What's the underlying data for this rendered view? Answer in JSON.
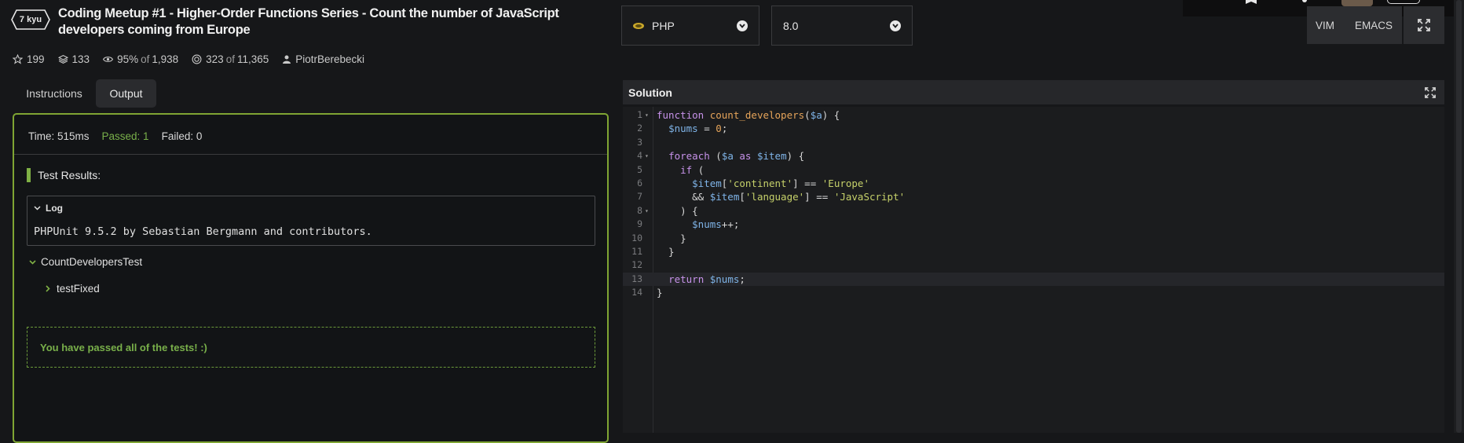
{
  "kata": {
    "rank": "7 kyu",
    "title": "Coding Meetup #1 - Higher-Order Functions Series - Count the number of JavaScript developers coming from Europe",
    "stats": {
      "stars": "199",
      "collections": "133",
      "satisfaction": "95%",
      "satisfaction_of": "of",
      "satisfaction_votes": "1,938",
      "completed": "323",
      "completed_of": "of",
      "completed_total": "11,365",
      "author": "PiotrBerebecki"
    }
  },
  "language_select": {
    "value": "PHP"
  },
  "version_select": {
    "value": "8.0"
  },
  "editor_modes": {
    "vim": "VIM",
    "emacs": "EMACS"
  },
  "tabs": {
    "instructions": "Instructions",
    "output": "Output"
  },
  "output": {
    "time": "Time: 515ms",
    "passed": "Passed: 1",
    "failed": "Failed: 0",
    "results_heading": "Test Results:",
    "log_label": "Log",
    "log_text": "PHPUnit 9.5.2 by Sebastian Bergmann and contributors.",
    "suite": "CountDevelopersTest",
    "test": "testFixed",
    "pass_message": "You have passed all of the tests! :)"
  },
  "solution": {
    "heading": "Solution",
    "lines": [
      [
        {
          "t": "kw",
          "v": "function "
        },
        {
          "t": "fn",
          "v": "count_developers"
        },
        {
          "t": "plain",
          "v": "("
        },
        {
          "t": "var",
          "v": "$a"
        },
        {
          "t": "plain",
          "v": ") {"
        }
      ],
      [
        {
          "t": "plain",
          "v": "  "
        },
        {
          "t": "var",
          "v": "$nums"
        },
        {
          "t": "plain",
          "v": " = "
        },
        {
          "t": "num",
          "v": "0"
        },
        {
          "t": "plain",
          "v": ";"
        }
      ],
      [],
      [
        {
          "t": "plain",
          "v": "  "
        },
        {
          "t": "kw",
          "v": "foreach"
        },
        {
          "t": "plain",
          "v": " ("
        },
        {
          "t": "var",
          "v": "$a"
        },
        {
          "t": "kw",
          "v": " as "
        },
        {
          "t": "var",
          "v": "$item"
        },
        {
          "t": "plain",
          "v": ") {"
        }
      ],
      [
        {
          "t": "plain",
          "v": "    "
        },
        {
          "t": "kw",
          "v": "if"
        },
        {
          "t": "plain",
          "v": " ("
        }
      ],
      [
        {
          "t": "plain",
          "v": "      "
        },
        {
          "t": "var",
          "v": "$item"
        },
        {
          "t": "plain",
          "v": "["
        },
        {
          "t": "str",
          "v": "'continent'"
        },
        {
          "t": "plain",
          "v": "] == "
        },
        {
          "t": "str",
          "v": "'Europe'"
        }
      ],
      [
        {
          "t": "plain",
          "v": "      && "
        },
        {
          "t": "var",
          "v": "$item"
        },
        {
          "t": "plain",
          "v": "["
        },
        {
          "t": "str",
          "v": "'language'"
        },
        {
          "t": "plain",
          "v": "] == "
        },
        {
          "t": "str",
          "v": "'JavaScript'"
        }
      ],
      [
        {
          "t": "plain",
          "v": "    ) {"
        }
      ],
      [
        {
          "t": "plain",
          "v": "      "
        },
        {
          "t": "var",
          "v": "$nums"
        },
        {
          "t": "plain",
          "v": "++;"
        }
      ],
      [
        {
          "t": "plain",
          "v": "    }"
        }
      ],
      [
        {
          "t": "plain",
          "v": "  }"
        }
      ],
      [],
      [
        {
          "t": "plain",
          "v": "  "
        },
        {
          "t": "kw",
          "v": "return "
        },
        {
          "t": "var",
          "v": "$nums"
        },
        {
          "t": "plain",
          "v": ";"
        }
      ],
      [
        {
          "t": "plain",
          "v": "}"
        }
      ]
    ],
    "fold_lines": [
      1,
      4,
      8
    ],
    "highlighted_line": 13
  }
}
